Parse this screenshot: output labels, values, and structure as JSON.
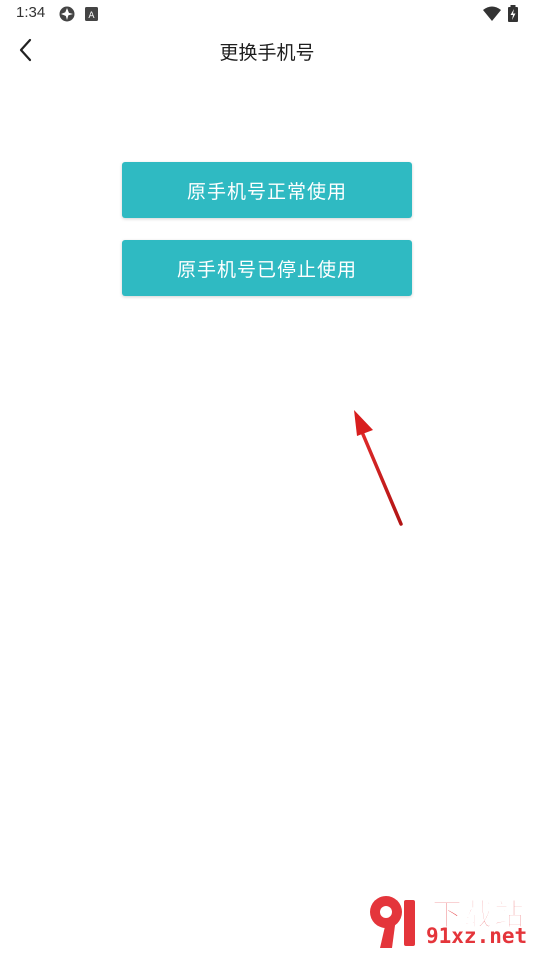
{
  "theme": {
    "accent": "#2fbac2",
    "arrow": "#d81e1e",
    "watermark": "#e4353b"
  },
  "status_bar": {
    "time": "1:34",
    "left_icons": [
      "vpn-icon",
      "keyboard-a-icon"
    ],
    "right_icons": [
      "wifi-icon",
      "battery-charging-icon"
    ]
  },
  "app_bar": {
    "back_icon": "chevron-left-icon",
    "title": "更换手机号"
  },
  "options": {
    "normal_label": "原手机号正常使用",
    "stopped_label": "原手机号已停止使用"
  },
  "watermark": {
    "brand": "下载站",
    "domain": "91xz.net",
    "logo_text": "9"
  }
}
